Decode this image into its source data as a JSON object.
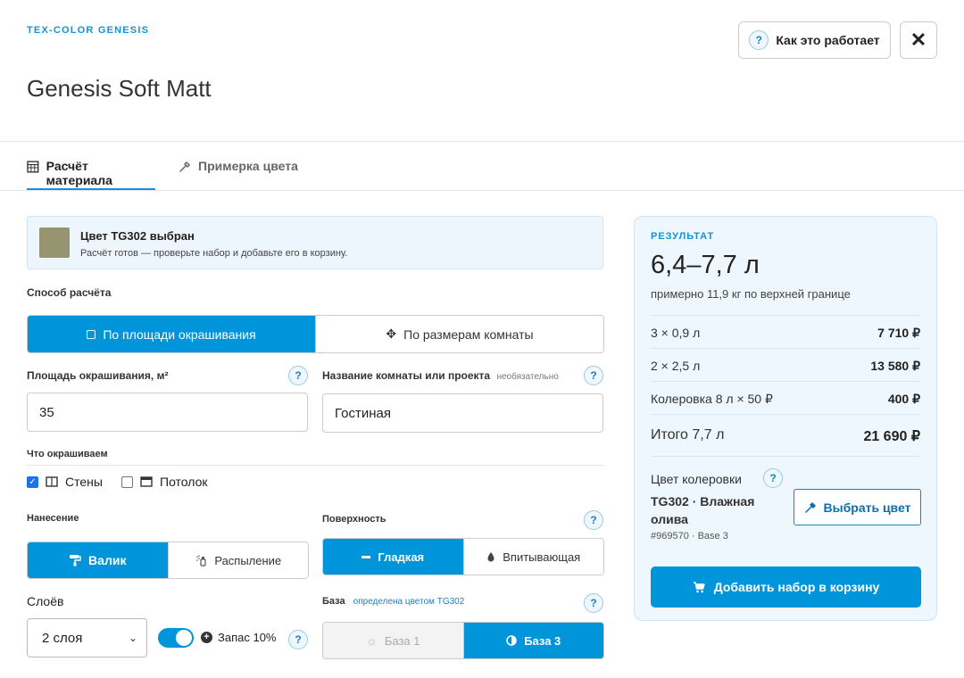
{
  "header": {
    "brand": "TEX-COLOR GENESIS",
    "title": "Genesis Soft Matt",
    "help_label": "Как это работает",
    "close_symbol": "✕"
  },
  "tabs": [
    {
      "label": "Расчёт материала",
      "icon": "calculator-icon",
      "active": true
    },
    {
      "label": "Примерка цвета",
      "icon": "eyedropper-icon",
      "active": false
    }
  ],
  "notice": {
    "swatch_color": "#969570",
    "title": "Цвет TG302 выбран",
    "text": "Расчёт готов — проверьте набор и добавьте его в корзину."
  },
  "calc_method": {
    "label": "Способ расчёта",
    "options": [
      "По площади окрашивания",
      "По размерам комнаты"
    ],
    "selected": 0
  },
  "area": {
    "label": "Площадь окрашивания, м²",
    "value": "35"
  },
  "room_name": {
    "label": "Название комнаты или проекта",
    "hint": "необязательно",
    "value": "Гостиная"
  },
  "what_painted": {
    "label": "Что окрашиваем",
    "items": [
      {
        "label": "Стены",
        "checked": true
      },
      {
        "label": "Потолок",
        "checked": false
      }
    ]
  },
  "application": {
    "label": "Нанесение",
    "options": [
      "Валик",
      "Распыление"
    ],
    "selected": 0
  },
  "surface": {
    "label": "Поверхность",
    "options": [
      "Гладкая",
      "Впитывающая"
    ],
    "selected": 0
  },
  "layers": {
    "label": "Слоёв",
    "value": "2 слоя"
  },
  "reserve": {
    "label": "Запас 10%",
    "on": true
  },
  "base": {
    "label": "База",
    "hint": "определена цветом TG302",
    "options": [
      "База 1",
      "База 3"
    ],
    "selected": 1
  },
  "result": {
    "label": "РЕЗУЛЬТАТ",
    "volume": "6,4–7,7 л",
    "weight_note": "примерно 11,9 кг по верхней границе",
    "rows": [
      {
        "name": "3 × 0,9 л",
        "price": "7 710 ₽"
      },
      {
        "name": "2 × 2,5 л",
        "price": "13 580 ₽"
      },
      {
        "name": "Колеровка 8 л × 50 ₽",
        "price": "400 ₽"
      }
    ],
    "total_name": "Итого 7,7 л",
    "total_price": "21 690 ₽",
    "color_label": "Цвет колеровки",
    "color_name": "TG302 · Влажная олива",
    "color_meta": "#969570 · Base 3",
    "pick_label": "Выбрать цвет",
    "cart_label": "Добавить набор в корзину"
  }
}
